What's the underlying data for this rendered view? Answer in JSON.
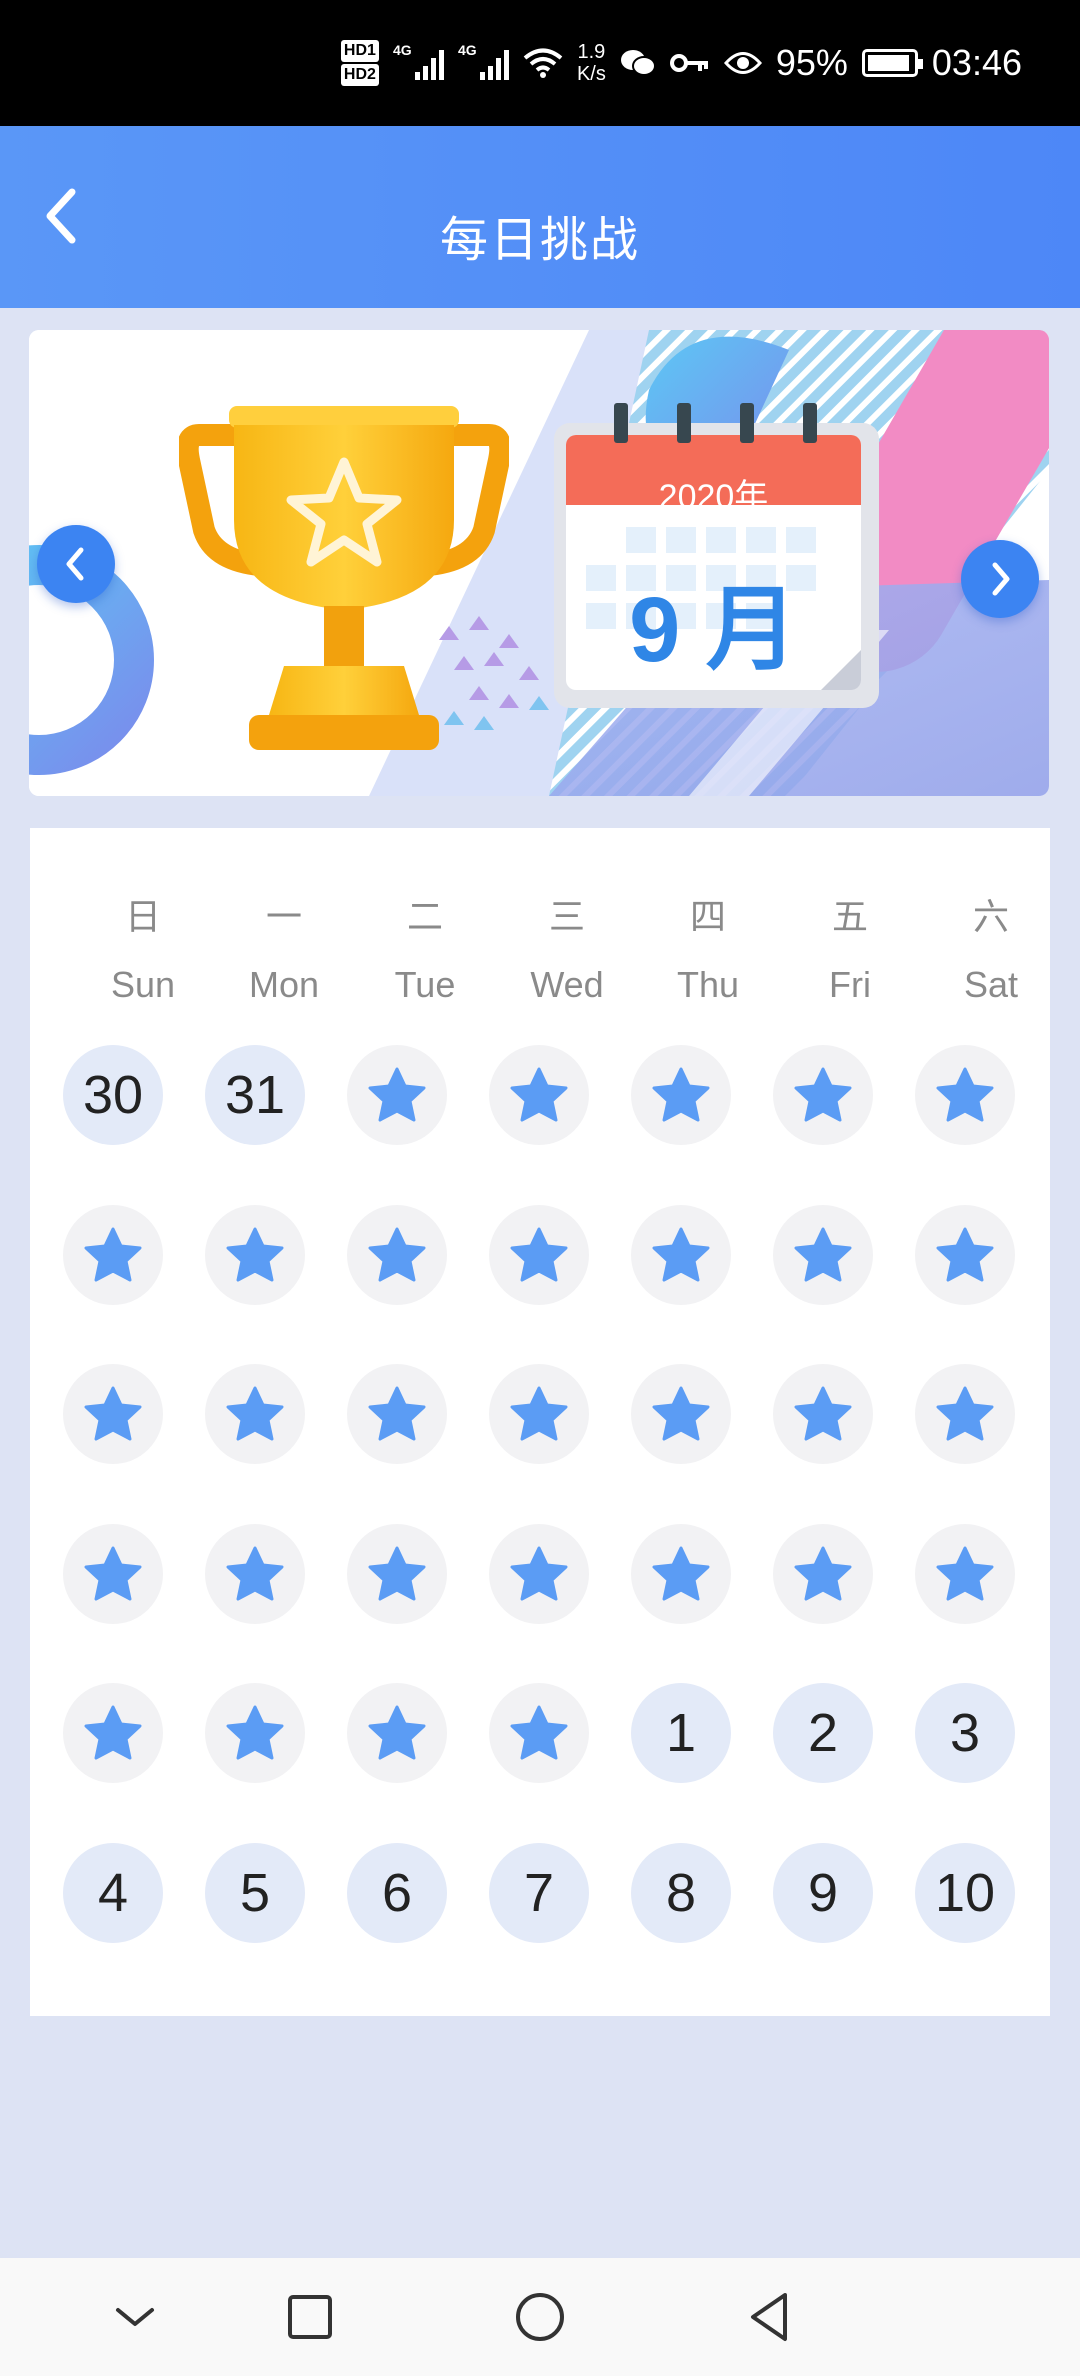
{
  "status_bar": {
    "hd_top": "HD1",
    "hd_bottom": "HD2",
    "network1": "4G",
    "network2": "4G",
    "speed_value": "1.9",
    "speed_unit": "K/s",
    "battery": "95%",
    "time": "03:46"
  },
  "header": {
    "title": "每日挑战"
  },
  "banner": {
    "year": "2020年",
    "month": "9 月"
  },
  "calendar": {
    "weekdays_cn": [
      "日",
      "一",
      "二",
      "三",
      "四",
      "五",
      "六"
    ],
    "weekdays_en": [
      "Sun",
      "Mon",
      "Tue",
      "Wed",
      "Thu",
      "Fri",
      "Sat"
    ],
    "star_color": "#5b9cf4",
    "cells": [
      "30",
      "31",
      "★",
      "★",
      "★",
      "★",
      "★",
      "★",
      "★",
      "★",
      "★",
      "★",
      "★",
      "★",
      "★",
      "★",
      "★",
      "★",
      "★",
      "★",
      "★",
      "★",
      "★",
      "★",
      "★",
      "★",
      "★",
      "★",
      "★",
      "★",
      "★",
      "★",
      "1",
      "2",
      "3",
      "4",
      "5",
      "6",
      "7",
      "8",
      "9",
      "10"
    ]
  },
  "icons": {
    "back": "chevron-left-icon",
    "prev": "chevron-left-icon",
    "next": "chevron-right-icon",
    "star": "star-icon",
    "trophy": "trophy-icon"
  }
}
